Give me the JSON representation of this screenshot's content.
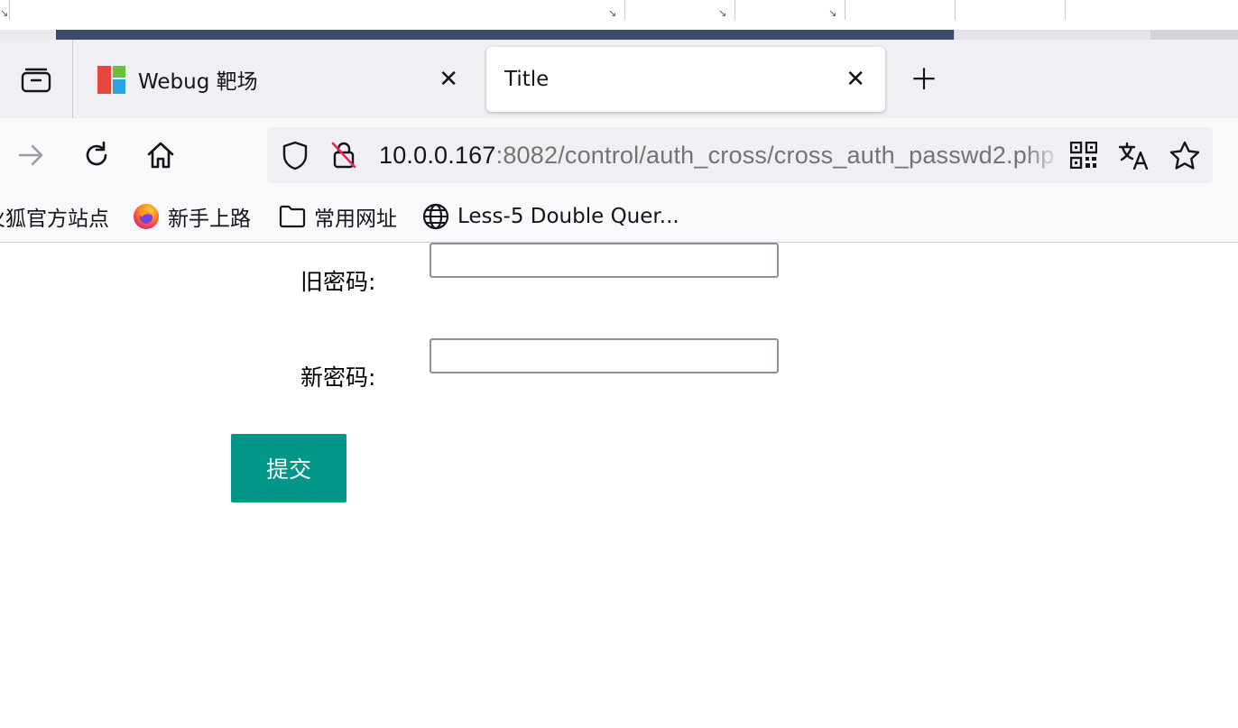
{
  "tabs": [
    {
      "title": "Webug 靶场",
      "active": false
    },
    {
      "title": "Title",
      "active": true
    }
  ],
  "address_bar": {
    "host": "10.0.0.167",
    "path": ":8082/control/auth_cross/cross_auth_passwd2.php"
  },
  "bookmarks": [
    {
      "label": "火狐官方站点",
      "icon": "firefox-logo-icon"
    },
    {
      "label": "新手上路",
      "icon": "firefox-logo-icon"
    },
    {
      "label": "常用网址",
      "icon": "folder-icon"
    },
    {
      "label": "Less-5 Double Quer...",
      "icon": "globe-icon"
    }
  ],
  "form": {
    "old_password_label": "旧密码:",
    "new_password_label": "新密码:",
    "old_password_value": "",
    "new_password_value": "",
    "submit_label": "提交"
  },
  "colors": {
    "submit_button": "#009688",
    "tab_strip": "#f0f0f4",
    "url_bar": "#f0f0f4"
  }
}
